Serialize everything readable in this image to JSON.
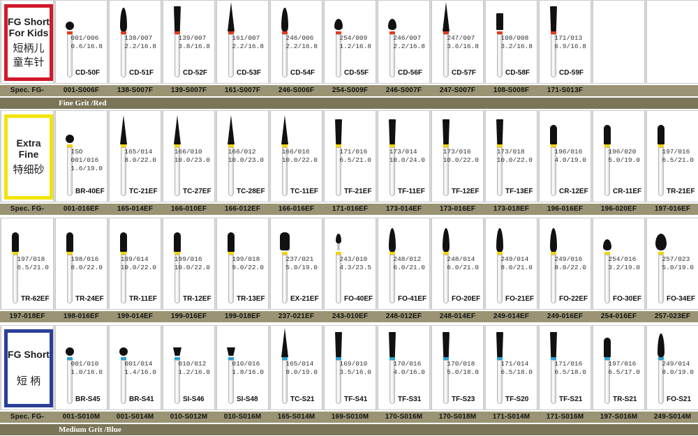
{
  "sections": [
    {
      "id": "fg-short-kids",
      "label_en": [
        "FG Short",
        "For Kids"
      ],
      "label_zh": [
        "短柄儿",
        "童车针"
      ],
      "label_color": "#d0192a",
      "ring_color": "#e53a1e",
      "spec_label": "Spec. FG-",
      "grit_text": "Fine Grit /Red",
      "items": [
        {
          "spec": "001/006",
          "size": "0.6/16.8",
          "model": "CD-50F",
          "code": "001-S006F",
          "head": "ball"
        },
        {
          "spec": "138/007",
          "size": "2.2/16.8",
          "model": "CD-51F",
          "code": "138-S007F",
          "head": "flame"
        },
        {
          "spec": "139/007",
          "size": "3.8/16.8",
          "model": "CD-52F",
          "code": "139-S007F",
          "head": "taper"
        },
        {
          "spec": "161/007",
          "size": "2.2/16.8",
          "model": "CD-53F",
          "code": "161-S007F",
          "head": "needle"
        },
        {
          "spec": "246/006",
          "size": "2.2/16.8",
          "model": "CD-54F",
          "code": "246-S006F",
          "head": "flame"
        },
        {
          "spec": "254/009",
          "size": "1.2/16.8",
          "model": "CD-55F",
          "code": "254-S009F",
          "head": "bud"
        },
        {
          "spec": "246/007",
          "size": "2.2/16.8",
          "model": "CD-56F",
          "code": "246-S007F",
          "head": "bud"
        },
        {
          "spec": "247/007",
          "size": "3.6/16.8",
          "model": "CD-57F",
          "code": "247-S007F",
          "head": "needle"
        },
        {
          "spec": "108/008",
          "size": "3.2/16.8",
          "model": "CD-58F",
          "code": "108-S008F",
          "head": "cyl"
        },
        {
          "spec": "171/013",
          "size": "6.9/16.8",
          "model": "CD-59F",
          "code": "171-S013F",
          "head": "taper"
        },
        {
          "spec": "",
          "size": "",
          "model": "",
          "code": "",
          "head": "none"
        },
        {
          "spec": "",
          "size": "",
          "model": "",
          "code": "",
          "head": "none"
        }
      ]
    },
    {
      "id": "extra-fine",
      "label_en": [
        "Extra",
        "Fine"
      ],
      "label_zh": [
        "特细砂"
      ],
      "label_color": "#f2e40c",
      "ring_color": "#f4d400",
      "spec_label": "Spec. FG-",
      "grit_text": "",
      "items": [
        {
          "iso": "ISO",
          "spec": "001/016",
          "size": "1.6/19.0",
          "model": "BR-40EF",
          "code": "001-016EF",
          "head": "ball"
        },
        {
          "spec": "165/014",
          "size": "8.0/22.0",
          "model": "TC-21EF",
          "code": "165-014EF",
          "head": "needle"
        },
        {
          "spec": "166/010",
          "size": "10.0/23.0",
          "model": "TC-27EF",
          "code": "166-010EF",
          "head": "needle"
        },
        {
          "spec": "166/012",
          "size": "10.0/23.0",
          "model": "TC-28EF",
          "code": "166-012EF",
          "head": "needle"
        },
        {
          "spec": "166/016",
          "size": "10.0/22.0",
          "model": "TC-11EF",
          "code": "166-016EF",
          "head": "needle"
        },
        {
          "spec": "171/016",
          "size": "6.5/21.0",
          "model": "TF-21EF",
          "code": "171-016EF",
          "head": "taper"
        },
        {
          "spec": "173/014",
          "size": "10.0/24.0",
          "model": "TF-11EF",
          "code": "173-014EF",
          "head": "taper"
        },
        {
          "spec": "173/016",
          "size": "10.0/22.0",
          "model": "TF-12EF",
          "code": "173-016EF",
          "head": "taper"
        },
        {
          "spec": "173/018",
          "size": "10.0/22.0",
          "model": "TF-13EF",
          "code": "173-018EF",
          "head": "taper"
        },
        {
          "spec": "196/016",
          "size": "4.0/19.0",
          "model": "CR-12EF",
          "code": "196-016EF",
          "head": "round"
        },
        {
          "spec": "196/020",
          "size": "5.0/19.0",
          "model": "CR-11EF",
          "code": "196-020EF",
          "head": "round"
        },
        {
          "spec": "197/016",
          "size": "6.5/21.0",
          "model": "TR-21EF",
          "code": "197-016EF",
          "head": "round"
        }
      ]
    },
    {
      "id": "extra-fine-2",
      "label_en": [],
      "label_zh": [],
      "label_color": "",
      "ring_color": "#f4d400",
      "spec_label": "",
      "grit_text": "",
      "items": [
        {
          "spec": "197/018",
          "size": "6.5/21.0",
          "model": "TR-62EF",
          "code": "197-018EF",
          "head": "round"
        },
        {
          "spec": "198/016",
          "size": "8.0/22.0",
          "model": "TR-24EF",
          "code": "198-016EF",
          "head": "round"
        },
        {
          "spec": "199/014",
          "size": "10.0/22.0",
          "model": "TR-11EF",
          "code": "199-014EF",
          "head": "round"
        },
        {
          "spec": "199/016",
          "size": "10.0/22.0",
          "model": "TR-12EF",
          "code": "199-016EF",
          "head": "round"
        },
        {
          "spec": "199/018",
          "size": "9.0/22.0",
          "model": "TR-13EF",
          "code": "199-018EF",
          "head": "round"
        },
        {
          "spec": "237/021",
          "size": "5.0/19.0",
          "model": "EX-21EF",
          "code": "237-021EF",
          "head": "ex"
        },
        {
          "spec": "243/010",
          "size": "4.3/23.5",
          "model": "FO-40EF",
          "code": "243-010EF",
          "head": "fo"
        },
        {
          "spec": "248/012",
          "size": "6.0/21.0",
          "model": "FO-41EF",
          "code": "248-012EF",
          "head": "flame"
        },
        {
          "spec": "248/014",
          "size": "6.0/21.0",
          "model": "FO-20EF",
          "code": "248-014EF",
          "head": "flame"
        },
        {
          "spec": "249/014",
          "size": "8.0/21.0",
          "model": "FO-21EF",
          "code": "249-014EF",
          "head": "flame"
        },
        {
          "spec": "249/016",
          "size": "8.0/22.0",
          "model": "FO-22EF",
          "code": "249-016EF",
          "head": "flame"
        },
        {
          "spec": "254/016",
          "size": "3.2/19.0",
          "model": "FO-30EF",
          "code": "254-016EF",
          "head": "bud"
        },
        {
          "spec": "257/023",
          "size": "5.0/19.0",
          "model": "FO-34EF",
          "code": "257-023EF",
          "head": "egg"
        }
      ]
    },
    {
      "id": "fg-short",
      "label_en": [
        "FG Short"
      ],
      "label_zh": [
        "短  柄"
      ],
      "label_color": "#2a3f97",
      "ring_color": "#2aa0d8",
      "spec_label": "Spec. FG-",
      "grit_text": "Medium Grit /Blue",
      "items": [
        {
          "spec": "001/010",
          "size": "1.0/16.0",
          "model": "BR-S45",
          "code": "001-S010M",
          "head": "ball"
        },
        {
          "spec": "001/014",
          "size": "1.4/16.0",
          "model": "BR-S41",
          "code": "001-S014M",
          "head": "ball"
        },
        {
          "spec": "010/012",
          "size": "1.2/16.0",
          "model": "SI-S46",
          "code": "010-S012M",
          "head": "inv"
        },
        {
          "spec": "010/016",
          "size": "1.8/16.0",
          "model": "SI-S48",
          "code": "010-S016M",
          "head": "inv"
        },
        {
          "spec": "165/014",
          "size": "8.0/19.0",
          "model": "TC-S21",
          "code": "165-S014M",
          "head": "needle"
        },
        {
          "spec": "169/010",
          "size": "3.5/16.0",
          "model": "TF-S41",
          "code": "169-S010M",
          "head": "taper"
        },
        {
          "spec": "170/016",
          "size": "4.0/16.0",
          "model": "TF-S31",
          "code": "170-S016M",
          "head": "taper"
        },
        {
          "spec": "170/018",
          "size": "5.0/18.0",
          "model": "TF-S23",
          "code": "170-S018M",
          "head": "taper"
        },
        {
          "spec": "171/014",
          "size": "6.5/18.0",
          "model": "TF-S20",
          "code": "171-S014M",
          "head": "taper"
        },
        {
          "spec": "171/016",
          "size": "6.5/18.0",
          "model": "TF-S21",
          "code": "171-S016M",
          "head": "taper"
        },
        {
          "spec": "197/016",
          "size": "6.5/17.0",
          "model": "TR-S21",
          "code": "197-S016M",
          "head": "round"
        },
        {
          "spec": "249/014",
          "size": "8.0/19.0",
          "model": "FO-S21",
          "code": "249-S014M",
          "head": "flame"
        }
      ]
    }
  ]
}
